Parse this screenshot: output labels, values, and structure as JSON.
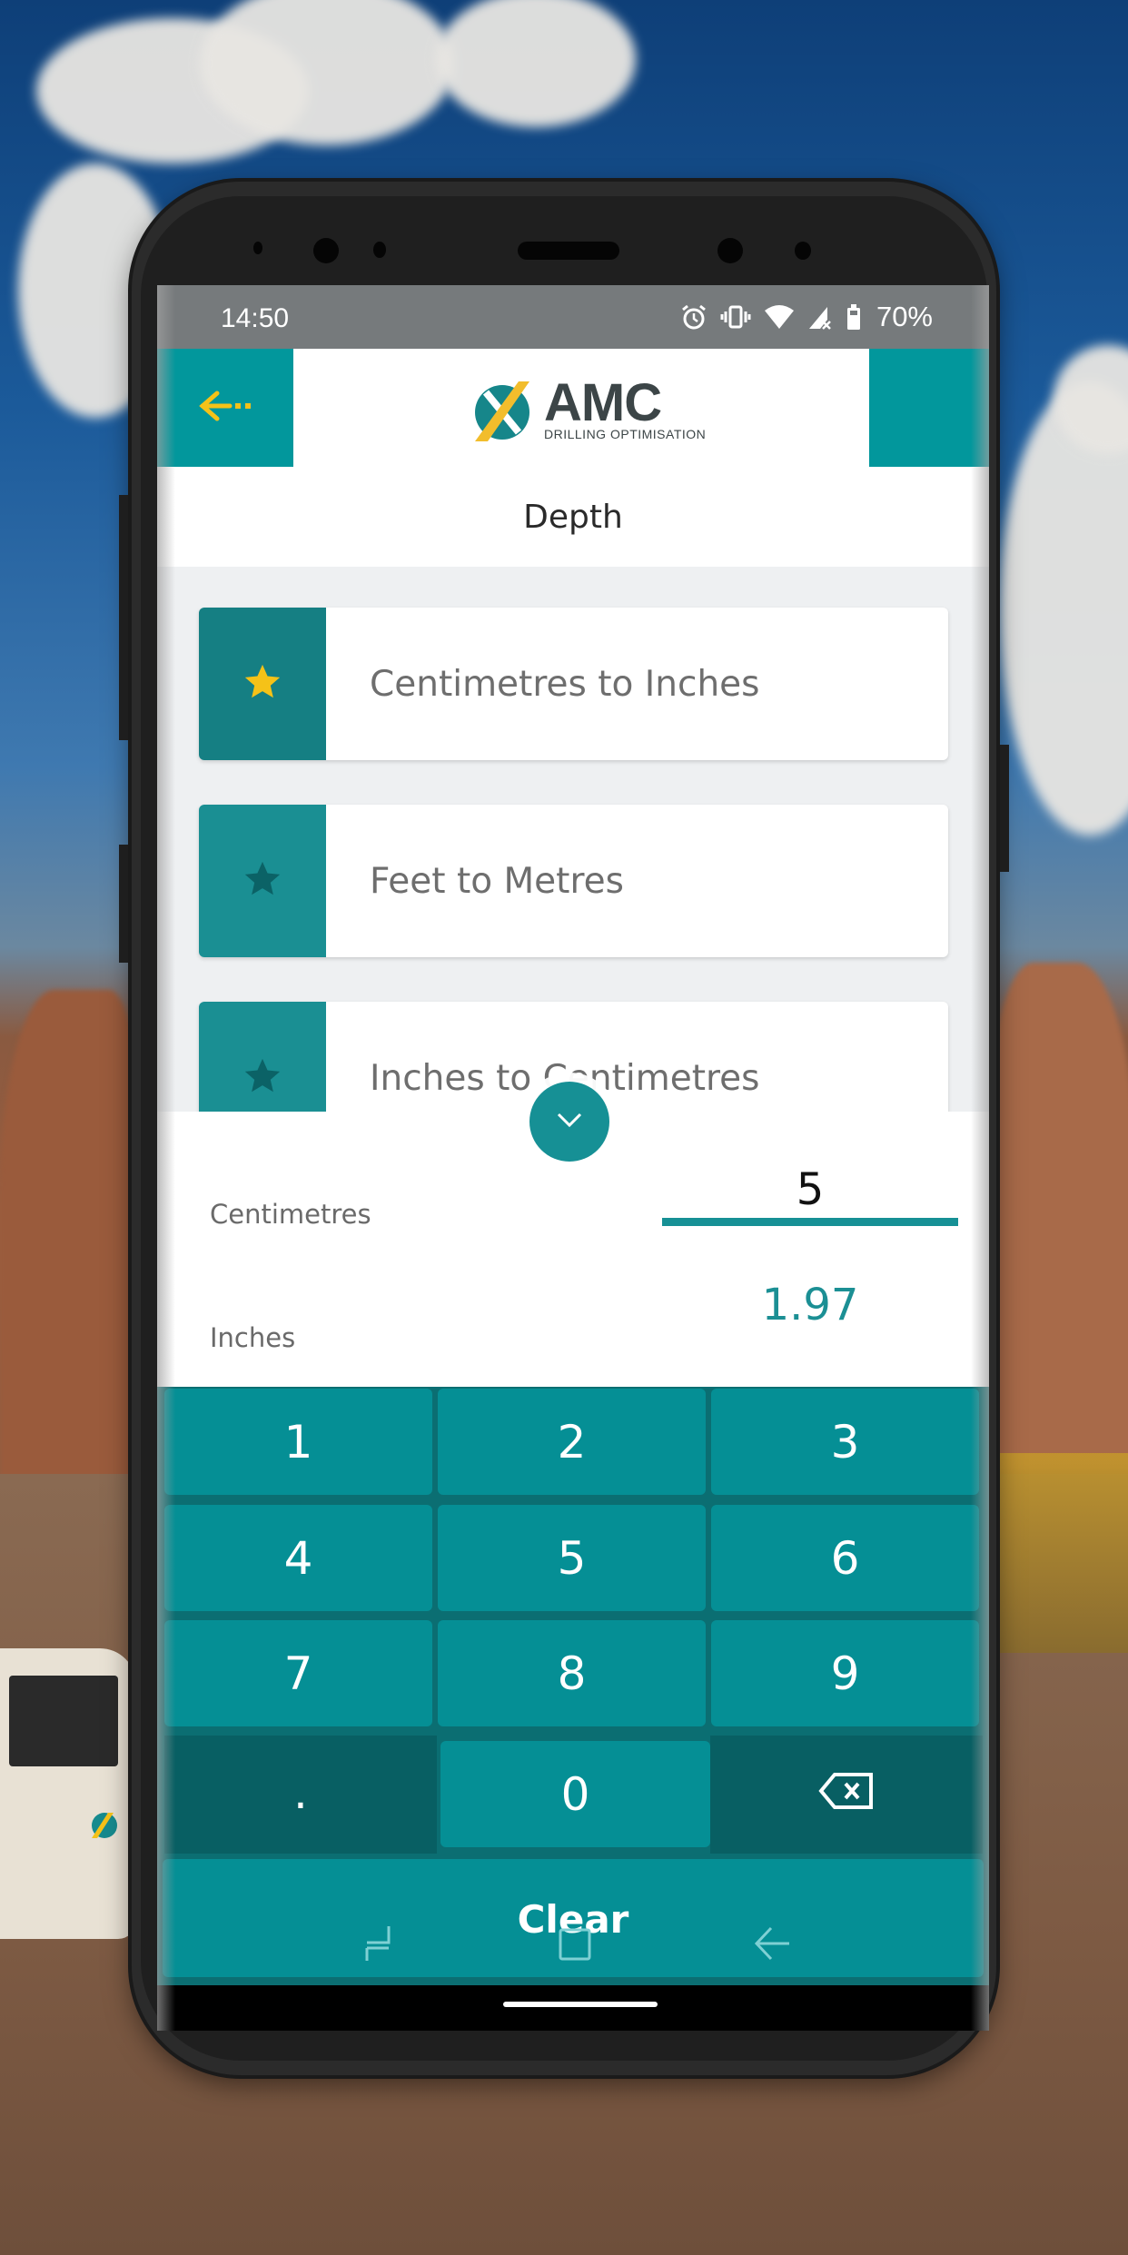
{
  "status_bar": {
    "time": "14:50",
    "icons": [
      "alarm-icon",
      "vibrate-icon",
      "wifi-icon",
      "no-signal-icon",
      "battery-icon"
    ],
    "battery_percent": "70%"
  },
  "app_bar": {
    "back_icon": "dashed-back-arrow-icon",
    "logo": {
      "name": "AMC",
      "tagline": "DRILLING OPTIMISATION"
    }
  },
  "page": {
    "title": "Depth"
  },
  "conversions": [
    {
      "label": "Centimetres to Inches",
      "favorite": true
    },
    {
      "label": "Feet to Metres",
      "favorite": false
    },
    {
      "label": "Inches to Centimetres",
      "favorite": false
    }
  ],
  "converter": {
    "collapse_icon": "chevron-down-icon",
    "from_unit": "Centimetres",
    "from_value": "5",
    "to_unit": "Inches",
    "to_value": "1.97"
  },
  "keypad": {
    "keys": [
      "1",
      "2",
      "3",
      "4",
      "5",
      "6",
      "7",
      "8",
      "9",
      ".",
      "0"
    ],
    "backspace_icon": "backspace-icon",
    "clear_label": "Clear"
  },
  "system_nav": {
    "icons": [
      "recents-icon",
      "home-icon",
      "back-icon"
    ]
  },
  "colors": {
    "primary_teal": "#02979c",
    "dark_teal": "#085f63",
    "favorite_star": "#f5c218",
    "inactive_star": "#0b6266",
    "output_text": "#1b8f94"
  }
}
